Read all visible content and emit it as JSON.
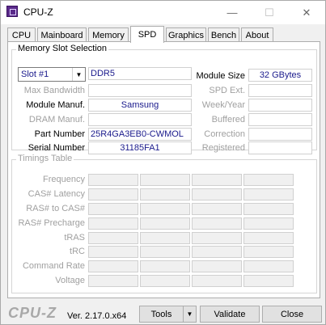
{
  "window": {
    "title": "CPU-Z",
    "controls": {
      "minimize": "—",
      "maximize": "☐",
      "close": "✕"
    }
  },
  "tabs": [
    {
      "label": "CPU",
      "active": false
    },
    {
      "label": "Mainboard",
      "active": false
    },
    {
      "label": "Memory",
      "active": false
    },
    {
      "label": "SPD",
      "active": true
    },
    {
      "label": "Graphics",
      "active": false
    },
    {
      "label": "Bench",
      "active": false
    },
    {
      "label": "About",
      "active": false
    }
  ],
  "slot_selection": {
    "legend": "Memory Slot Selection",
    "slot": "Slot #1",
    "type": "DDR5",
    "labels": {
      "max_bandwidth": "Max Bandwidth",
      "module_manuf": "Module Manuf.",
      "dram_manuf": "DRAM Manuf.",
      "part_number": "Part Number",
      "serial_number": "Serial Number",
      "module_size": "Module Size",
      "spd_ext": "SPD Ext.",
      "week_year": "Week/Year",
      "buffered": "Buffered",
      "correction": "Correction",
      "registered": "Registered"
    },
    "values": {
      "max_bandwidth": "",
      "module_manuf": "Samsung",
      "dram_manuf": "",
      "part_number": "25R4GA3EB0-CWMOL",
      "serial_number": "31185FA1",
      "module_size": "32 GBytes",
      "spd_ext": "",
      "week_year": "",
      "buffered": "",
      "correction": "",
      "registered": ""
    }
  },
  "timings": {
    "legend": "Timings Table",
    "rows": [
      "Frequency",
      "CAS# Latency",
      "RAS# to CAS#",
      "RAS# Precharge",
      "tRAS",
      "tRC",
      "Command Rate",
      "Voltage"
    ]
  },
  "footer": {
    "logo": "CPU-Z",
    "version": "Ver. 2.17.0.x64",
    "tools_label": "Tools",
    "validate_label": "Validate",
    "close_label": "Close"
  }
}
